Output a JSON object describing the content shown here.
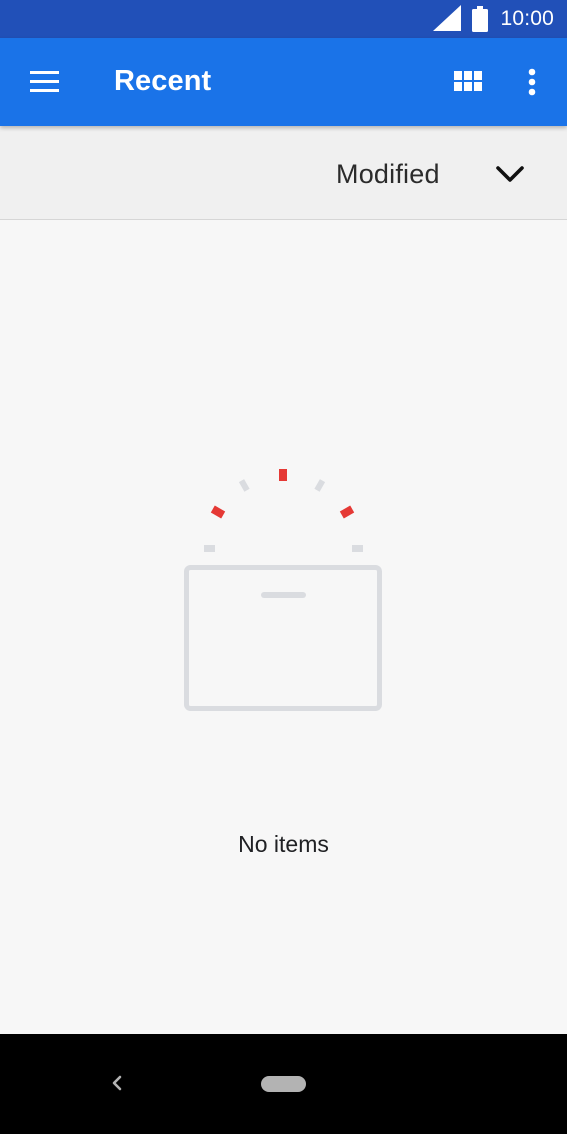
{
  "status_bar": {
    "time": "10:00",
    "icons": [
      "signal-icon",
      "battery-icon"
    ]
  },
  "app_bar": {
    "title": "Recent",
    "icons": [
      "menu-icon",
      "grid-view-icon",
      "more-vert-icon"
    ]
  },
  "sort": {
    "label": "Modified",
    "icon": "chevron-down-icon"
  },
  "empty_state": {
    "message": "No items",
    "illustration": "empty-folder-icon",
    "colors": {
      "accent_red": "#e53935",
      "light_gray": "#dadce0"
    }
  },
  "nav_bar": {
    "icons": [
      "back-icon",
      "home-pill-icon"
    ]
  },
  "colors": {
    "status_bar": "#2150b8",
    "app_bar": "#1a73e8",
    "sort_bar": "#f0f0f0",
    "background": "#f7f7f7",
    "nav_bar": "#000000"
  }
}
